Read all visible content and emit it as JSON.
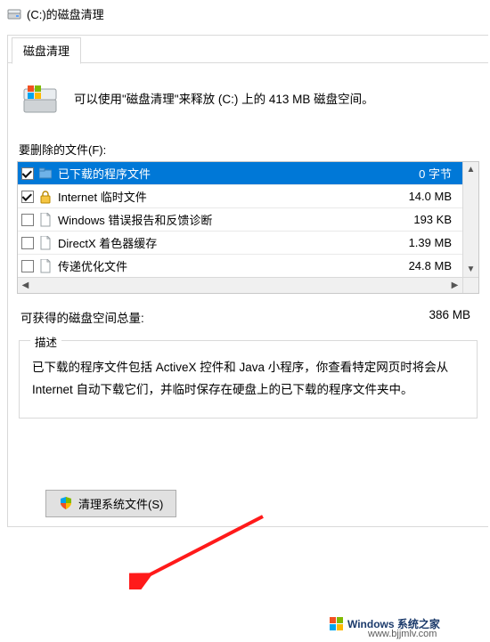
{
  "window": {
    "title": "(C:)的磁盘清理"
  },
  "tab": {
    "label": "磁盘清理"
  },
  "summary": {
    "text": "可以使用\"磁盘清理\"来释放  (C:) 上的 413 MB 磁盘空间。"
  },
  "files_label": "要删除的文件(F):",
  "rows": [
    {
      "checked": true,
      "icon": "folder",
      "name": "已下载的程序文件",
      "size": "0 字节",
      "selected": true
    },
    {
      "checked": true,
      "icon": "lock",
      "name": "Internet 临时文件",
      "size": "14.0 MB",
      "selected": false
    },
    {
      "checked": false,
      "icon": "file",
      "name": "Windows 错误报告和反馈诊断",
      "size": "193 KB",
      "selected": false
    },
    {
      "checked": false,
      "icon": "file",
      "name": "DirectX 着色器缓存",
      "size": "1.39 MB",
      "selected": false
    },
    {
      "checked": false,
      "icon": "file",
      "name": "传递优化文件",
      "size": "24.8 MB",
      "selected": false
    }
  ],
  "total": {
    "label": "可获得的磁盘空间总量:",
    "value": "386 MB"
  },
  "description": {
    "legend": "描述",
    "text": "已下载的程序文件包括 ActiveX 控件和 Java 小程序，你查看特定网页时将会从 Internet 自动下载它们，并临时保存在硬盘上的已下载的程序文件夹中。"
  },
  "clean_button": "清理系统文件(S)",
  "watermark": {
    "brand": "Windows 系统之家",
    "url": "www.bjjmlv.com"
  }
}
